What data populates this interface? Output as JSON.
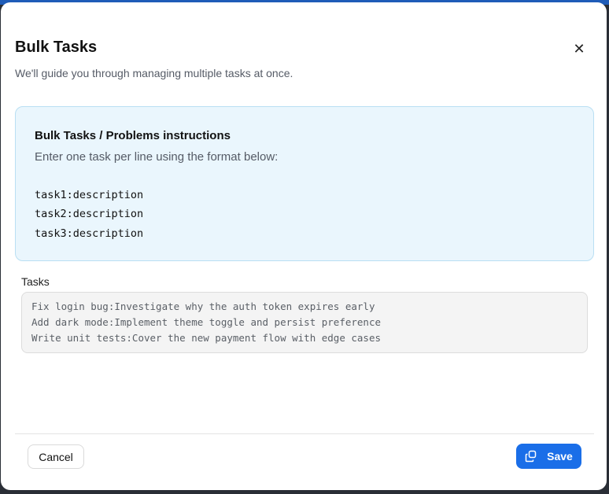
{
  "dialog": {
    "title": "Bulk Tasks",
    "subtitle": "We'll guide you through managing multiple tasks at once.",
    "close_icon": "close-icon"
  },
  "instructions": {
    "title": "Bulk Tasks / Problems instructions",
    "description": "Enter one task per line using the format below:",
    "format_lines": [
      "task1:description",
      "task2:description",
      "task3:description"
    ]
  },
  "tasks": {
    "label": "Tasks",
    "lines": [
      "Fix login bug:Investigate why the auth token expires early",
      "Add dark mode:Implement theme toggle and persist preference",
      "Write unit tests:Cover the new payment flow with edge cases"
    ]
  },
  "footer": {
    "cancel_label": "Cancel",
    "save_label": "Save",
    "save_icon": "copy-icon"
  },
  "colors": {
    "accent": "#1a6ee8",
    "info_bg": "#eaf6fd",
    "info_border": "#b9dff3"
  }
}
